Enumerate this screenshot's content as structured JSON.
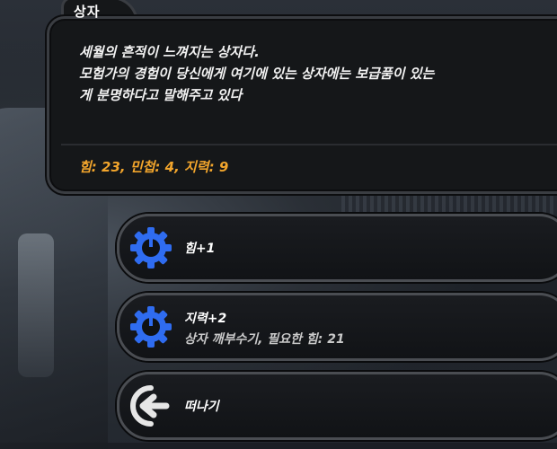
{
  "event": {
    "title": "상자",
    "description_lines": [
      "세월의 흔적이 느껴지는 상자다.",
      "모험가의 경험이 당신에게 여기에 있는 상자에는 보급품이 있는",
      "게 분명하다고 말해주고 있다"
    ],
    "stats": "힘: 23, 민첩: 4, 지력: 9"
  },
  "choices": [
    {
      "label": "힘+1",
      "icon": "gear-icon",
      "icon_color": "#2f6cf0"
    },
    {
      "label": "지력+2",
      "sublabel": "상자 깨부수기, 필요한 힘: 21",
      "icon": "gear-icon",
      "icon_color": "#2f6cf0"
    },
    {
      "label": "떠나기",
      "icon": "exit-arrow-icon",
      "icon_color": "#e6e6e6"
    }
  ],
  "colors": {
    "stats": "#f2a52c",
    "accent_blue": "#2f6cf0"
  }
}
